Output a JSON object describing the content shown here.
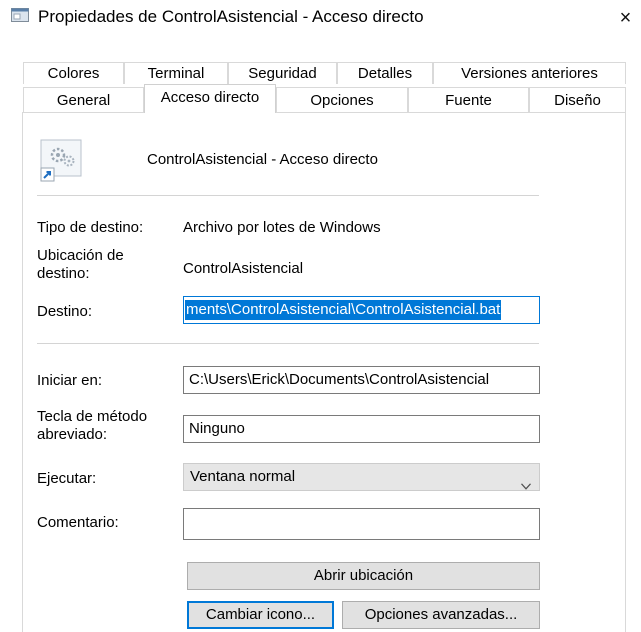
{
  "window": {
    "title": "Propiedades de ControlAsistencial - Acceso directo",
    "close_glyph": "×"
  },
  "tabs": {
    "row1": [
      "Colores",
      "Terminal",
      "Seguridad",
      "Detalles",
      "Versiones anteriores"
    ],
    "row2": [
      "General",
      "Acceso directo",
      "Opciones",
      "Fuente",
      "Diseño"
    ],
    "selected": "Acceso directo"
  },
  "shortcut": {
    "name": "ControlAsistencial - Acceso directo"
  },
  "fields": {
    "target_type_label": "Tipo de destino:",
    "target_type_value": "Archivo por lotes de Windows",
    "target_location_label": "Ubicación de destino:",
    "target_location_value": "ControlAsistencial",
    "target_label": "Destino:",
    "target_value": "ments\\ControlAsistencial\\ControlAsistencial.bat",
    "start_in_label": "Iniciar en:",
    "start_in_value": "C:\\Users\\Erick\\Documents\\ControlAsistencial",
    "shortcut_key_label": "Tecla de método abreviado:",
    "shortcut_key_value": "Ninguno",
    "run_label": "Ejecutar:",
    "run_value": "Ventana normal",
    "comment_label": "Comentario:",
    "comment_value": ""
  },
  "buttons": {
    "open_location": "Abrir ubicación",
    "change_icon": "Cambiar icono...",
    "advanced": "Opciones avanzadas..."
  },
  "colors": {
    "accent": "#0078d7",
    "button_bg": "#e1e1e1",
    "combo_bg": "#e6e6e6"
  }
}
